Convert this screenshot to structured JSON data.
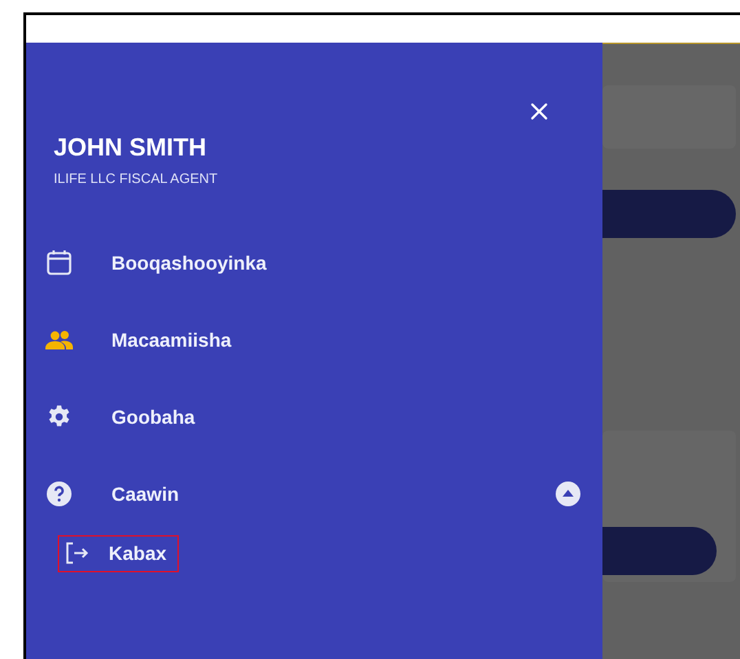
{
  "drawer": {
    "user_name": "JOHN SMITH",
    "user_role": "ILIFE LLC FISCAL AGENT",
    "items": [
      {
        "label": "Booqashooyinka"
      },
      {
        "label": "Macaamiisha"
      },
      {
        "label": "Goobaha"
      },
      {
        "label": "Caawin",
        "expanded": true,
        "children": [
          {
            "label": "Kabax",
            "selected": true
          }
        ]
      }
    ]
  }
}
